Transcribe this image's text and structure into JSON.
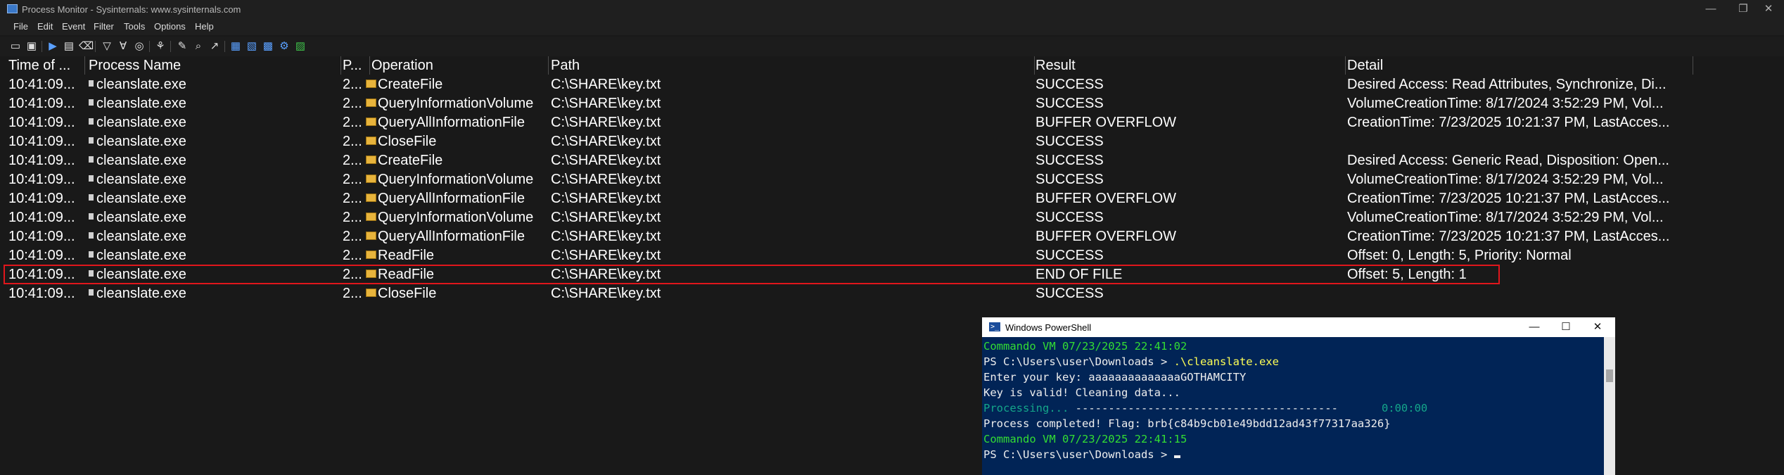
{
  "window": {
    "title": "Process Monitor - Sysinternals: www.sysinternals.com",
    "controls": [
      "—",
      "❐",
      "✕"
    ]
  },
  "menu": [
    "File",
    "Edit",
    "Event",
    "Filter",
    "Tools",
    "Options",
    "Help"
  ],
  "toolbar": {
    "icons": [
      "open-icon",
      "save-icon",
      "capture-icon",
      "autoscroll-icon",
      "clear-icon",
      "filter-icon",
      "highlight-icon",
      "include-process-icon",
      "process-tree-icon",
      "properties-icon",
      "find-icon",
      "jump-icon",
      "registry-activity-icon",
      "file-activity-icon",
      "network-activity-icon",
      "process-activity-icon",
      "profiling-activity-icon"
    ]
  },
  "table": {
    "columns": [
      "Time of ...",
      "Process Name",
      "P...",
      "Operation",
      "Path",
      "Result",
      "Detail"
    ],
    "rows": [
      {
        "time": "10:41:09...",
        "process": "cleanslate.exe",
        "pid": "2...",
        "operation": "CreateFile",
        "path": "C:\\SHARE\\key.txt",
        "result": "SUCCESS",
        "detail": "Desired Access: Read Attributes, Synchronize, Di..."
      },
      {
        "time": "10:41:09...",
        "process": "cleanslate.exe",
        "pid": "2...",
        "operation": "QueryInformationVolume",
        "path": "C:\\SHARE\\key.txt",
        "result": "SUCCESS",
        "detail": "VolumeCreationTime: 8/17/2024 3:52:29 PM, Vol..."
      },
      {
        "time": "10:41:09...",
        "process": "cleanslate.exe",
        "pid": "2...",
        "operation": "QueryAllInformationFile",
        "path": "C:\\SHARE\\key.txt",
        "result": "BUFFER OVERFLOW",
        "detail": "CreationTime: 7/23/2025 10:21:37 PM, LastAcces..."
      },
      {
        "time": "10:41:09...",
        "process": "cleanslate.exe",
        "pid": "2...",
        "operation": "CloseFile",
        "path": "C:\\SHARE\\key.txt",
        "result": "SUCCESS",
        "detail": ""
      },
      {
        "time": "10:41:09...",
        "process": "cleanslate.exe",
        "pid": "2...",
        "operation": "CreateFile",
        "path": "C:\\SHARE\\key.txt",
        "result": "SUCCESS",
        "detail": "Desired Access: Generic Read, Disposition: Open..."
      },
      {
        "time": "10:41:09...",
        "process": "cleanslate.exe",
        "pid": "2...",
        "operation": "QueryInformationVolume",
        "path": "C:\\SHARE\\key.txt",
        "result": "SUCCESS",
        "detail": "VolumeCreationTime: 8/17/2024 3:52:29 PM, Vol..."
      },
      {
        "time": "10:41:09...",
        "process": "cleanslate.exe",
        "pid": "2...",
        "operation": "QueryAllInformationFile",
        "path": "C:\\SHARE\\key.txt",
        "result": "BUFFER OVERFLOW",
        "detail": "CreationTime: 7/23/2025 10:21:37 PM, LastAcces..."
      },
      {
        "time": "10:41:09...",
        "process": "cleanslate.exe",
        "pid": "2...",
        "operation": "QueryInformationVolume",
        "path": "C:\\SHARE\\key.txt",
        "result": "SUCCESS",
        "detail": "VolumeCreationTime: 8/17/2024 3:52:29 PM, Vol..."
      },
      {
        "time": "10:41:09...",
        "process": "cleanslate.exe",
        "pid": "2...",
        "operation": "QueryAllInformationFile",
        "path": "C:\\SHARE\\key.txt",
        "result": "BUFFER OVERFLOW",
        "detail": "CreationTime: 7/23/2025 10:21:37 PM, LastAcces..."
      },
      {
        "time": "10:41:09...",
        "process": "cleanslate.exe",
        "pid": "2...",
        "operation": "ReadFile",
        "path": "C:\\SHARE\\key.txt",
        "result": "SUCCESS",
        "detail": "Offset: 0, Length: 5, Priority: Normal"
      },
      {
        "time": "10:41:09...",
        "process": "cleanslate.exe",
        "pid": "2...",
        "operation": "ReadFile",
        "path": "C:\\SHARE\\key.txt",
        "result": "END OF FILE",
        "detail": "Offset: 5, Length: 1"
      },
      {
        "time": "10:41:09...",
        "process": "cleanslate.exe",
        "pid": "2...",
        "operation": "CloseFile",
        "path": "C:\\SHARE\\key.txt",
        "result": "SUCCESS",
        "detail": ""
      }
    ]
  },
  "powershell": {
    "title": "Windows PowerShell",
    "controls": [
      "—",
      "☐",
      "✕"
    ],
    "lines": [
      {
        "text": "Commando VM 07/23/2025 22:41:02",
        "color": "green"
      },
      {
        "prompt": "PS C:\\Users\\user\\Downloads > ",
        "command": ".\\cleanslate.exe"
      },
      {
        "text": "Enter your key: aaaaaaaaaaaaaaGOTHAMCITY",
        "color": "white"
      },
      {
        "text": "Key is valid! Cleaning data...",
        "color": "white"
      },
      {
        "progress_label": "Processing... ",
        "progress_bar": "----------------------------------------",
        "progress_time": "0:00:00"
      },
      {
        "text": "Process completed! Flag: brb{c84b9cb01e49bdd12ad43f77317aa326}",
        "color": "white"
      },
      {
        "text": "Commando VM 07/23/2025 22:41:15",
        "color": "green"
      },
      {
        "prompt": "PS C:\\Users\\user\\Downloads > ",
        "command": ""
      }
    ]
  },
  "colors": {
    "background": "#191919",
    "highlight_border": "#e0161c",
    "powershell_bg": "#012456",
    "prompt_green": "#33dd33",
    "command_yellow": "#ffff55"
  }
}
